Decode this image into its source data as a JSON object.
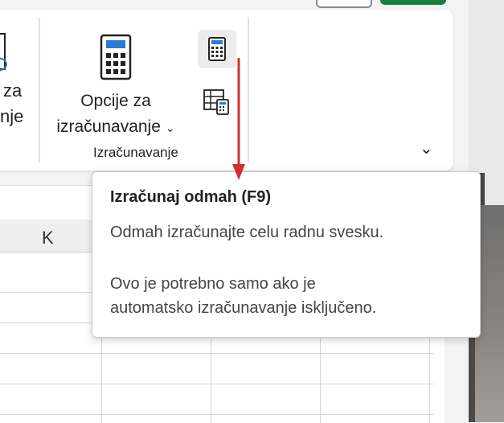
{
  "ribbon": {
    "partial_label_line1": "za",
    "partial_label_line2": "nje",
    "calc_options_line1": "Opcije za",
    "calc_options_line2": "izračunavanje",
    "calc_options_caret": "⌄",
    "group_label": "Izračunavanje",
    "collapse_caret": "⌄"
  },
  "sheet": {
    "column_label": "K"
  },
  "tooltip": {
    "title": "Izračunaj odmah (F9)",
    "line1": "Odmah izračunajte celu radnu svesku.",
    "line2": "Ovo je potrebno samo ako je",
    "line3": "automatsko izračunavanje isključeno."
  },
  "colors": {
    "annotation_arrow": "#d32f2f",
    "accent_green": "#15803d",
    "icon_blue": "#2b7bd6"
  }
}
